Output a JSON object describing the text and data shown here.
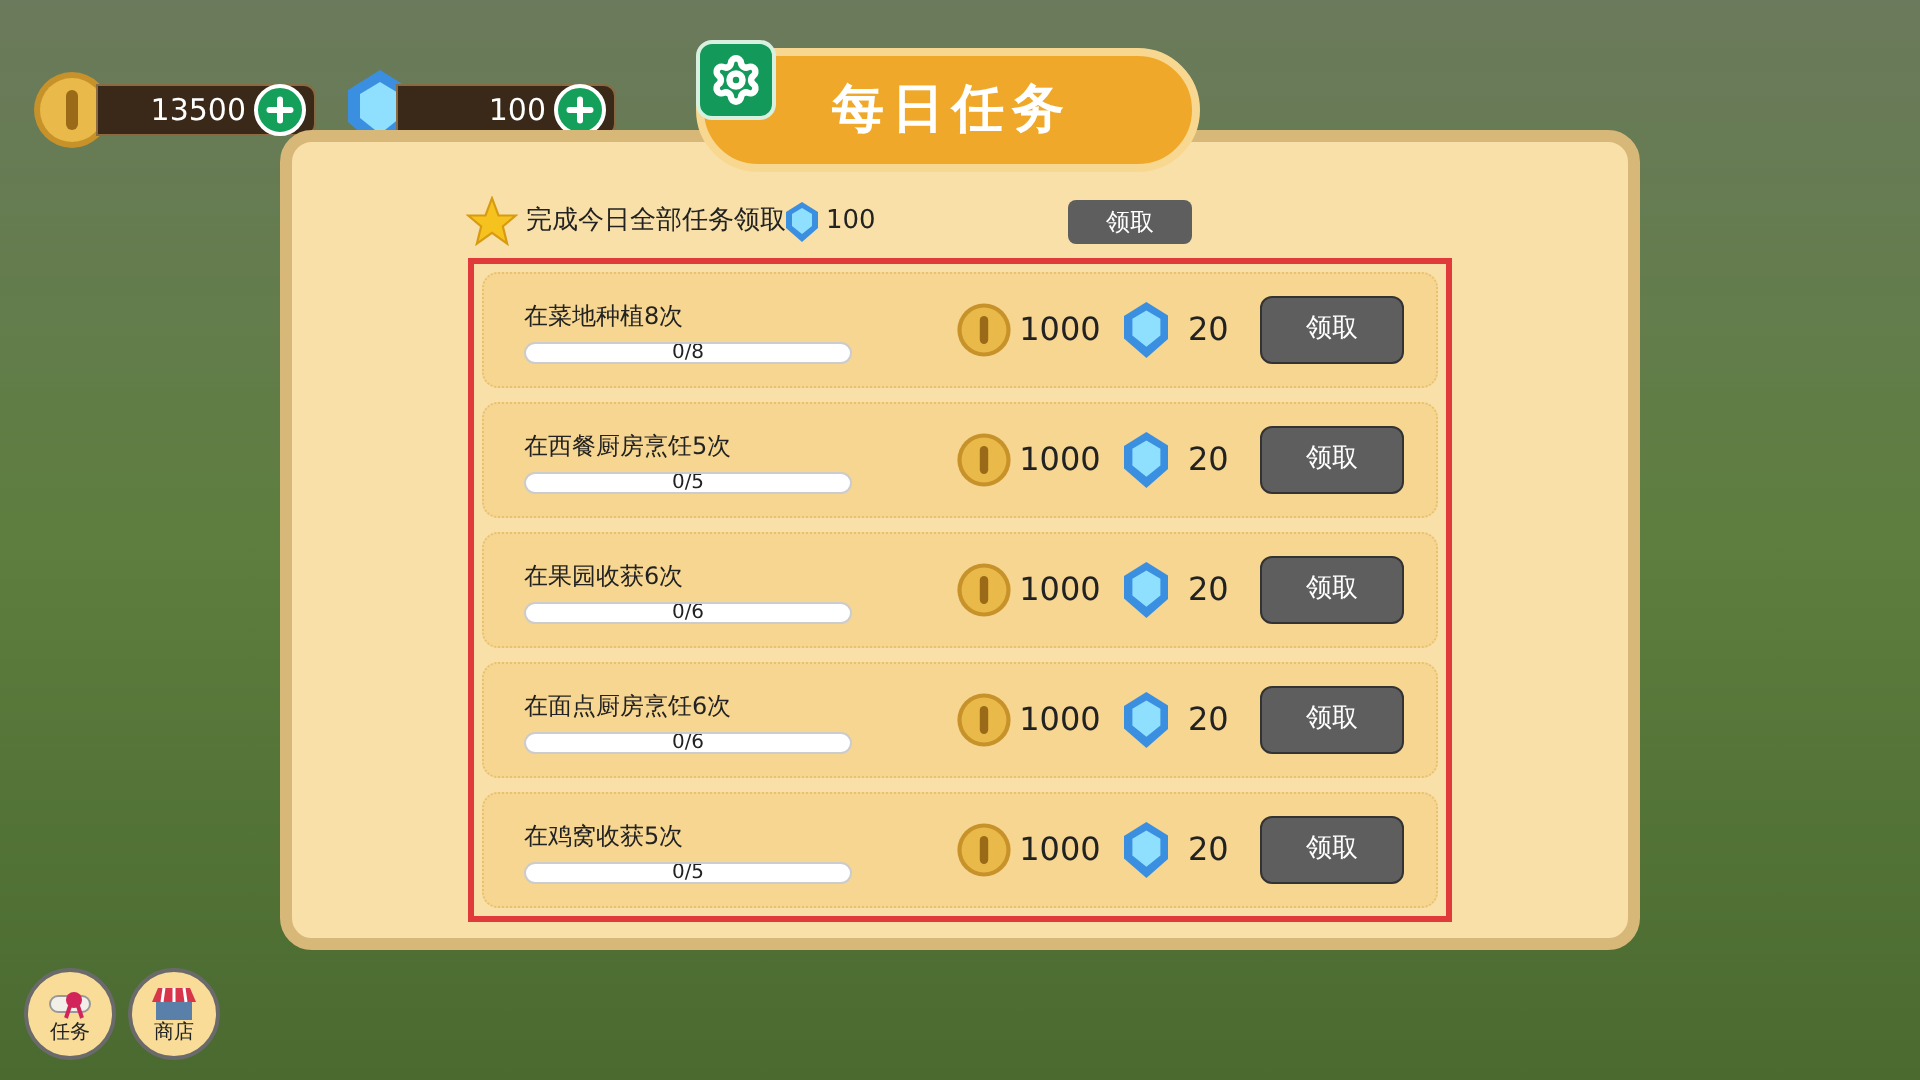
{
  "currencies": [
    {
      "kind": "coin",
      "amount": "13500"
    },
    {
      "kind": "gem",
      "amount": "100"
    }
  ],
  "title": "每日任务",
  "all_complete": {
    "text": "完成今日全部任务领取",
    "reward": "100",
    "button": "领取"
  },
  "tasks": [
    {
      "name": "在菜地种植8次",
      "progress": "0/8",
      "level": 0,
      "coins": "1000",
      "gems": "20",
      "button": "领取"
    },
    {
      "name": "在西餐厨房烹饪5次",
      "progress": "0/5",
      "level": 0,
      "coins": "1000",
      "gems": "20",
      "button": "领取"
    },
    {
      "name": "在果园收获6次",
      "progress": "0/6",
      "level": 0,
      "coins": "1000",
      "gems": "20",
      "button": "领取"
    },
    {
      "name": "在面点厨房烹饪6次",
      "progress": "0/6",
      "level": 0,
      "coins": "1000",
      "gems": "20",
      "button": "领取"
    },
    {
      "name": "在鸡窝收获5次",
      "progress": "0/5",
      "level": 0,
      "coins": "1000",
      "gems": "20",
      "button": "领取"
    }
  ],
  "bottom_buttons": [
    {
      "kind": "tasks",
      "label": "任务"
    },
    {
      "kind": "shop",
      "label": "商店"
    }
  ]
}
